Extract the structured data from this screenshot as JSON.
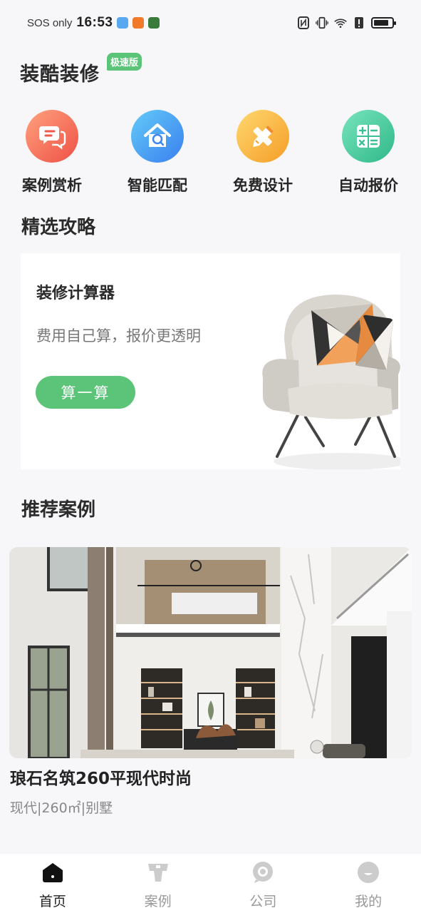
{
  "status_bar": {
    "carrier": "SOS only",
    "time": "16:53",
    "battery_level": 0.85
  },
  "app": {
    "logo_text": "装酷装修",
    "logo_badge": "极速版",
    "brand_color": "#5cc478"
  },
  "quick_menu": [
    {
      "label": "案例赏析",
      "icon": "chat-bubble-icon",
      "color_from": "#ff9a7a",
      "color_to": "#f0564a"
    },
    {
      "label": "智能匹配",
      "icon": "house-search-icon",
      "color_from": "#5ec5f5",
      "color_to": "#3a7ff0"
    },
    {
      "label": "免费设计",
      "icon": "pencil-ruler-icon",
      "color_from": "#ffd36b",
      "color_to": "#f5a128"
    },
    {
      "label": "自动报价",
      "icon": "calculator-icon",
      "color_from": "#6fe0b8",
      "color_to": "#2fb889"
    }
  ],
  "featured": {
    "section_title": "精选攻略",
    "card_title": "装修计算器",
    "card_subtitle": "费用自己算，报价更透明",
    "card_button": "算一算"
  },
  "recommended": {
    "section_title": "推荐案例",
    "cases": [
      {
        "title": "琅石名筑260平现代时尚",
        "meta": "现代|260㎡|别墅"
      }
    ]
  },
  "tab_bar": [
    {
      "label": "首页",
      "icon": "home-icon",
      "active": true
    },
    {
      "label": "案例",
      "icon": "case-icon",
      "active": false
    },
    {
      "label": "公司",
      "icon": "company-icon",
      "active": false
    },
    {
      "label": "我的",
      "icon": "profile-icon",
      "active": false
    }
  ]
}
